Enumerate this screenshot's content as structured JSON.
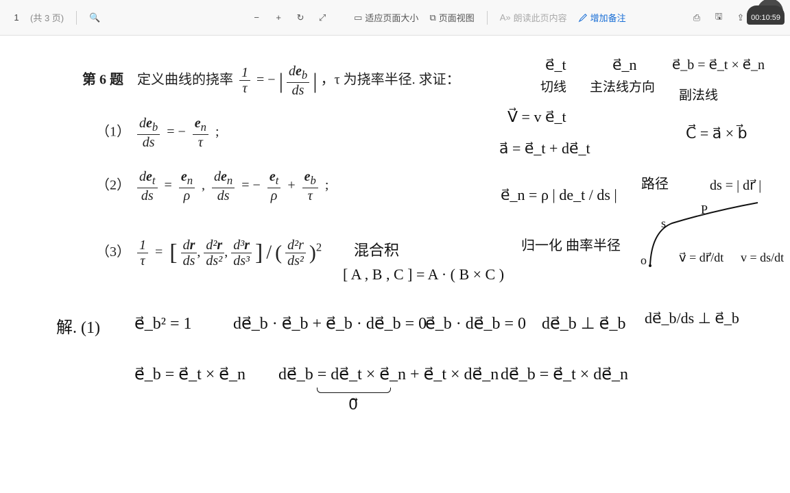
{
  "toolbar": {
    "page_current": "1",
    "page_total": "(共 3 页)",
    "search_icon": "🔍",
    "zoom_out": "−",
    "zoom_in": "+",
    "rotate_icon": "↻",
    "collapse_icon": "⤢",
    "fit_icon": "▭",
    "fit_label": "适应页面大小",
    "pageview_icon": "⧉",
    "pageview_label": "页面视图",
    "read_icon": "A»",
    "read_label": "朗读此页内容",
    "note_icon": "✎",
    "note_label": "增加备注",
    "print_icon": "⎙",
    "save_icon": "🖫",
    "export_icon": "⇪",
    "timer": "00:10:59"
  },
  "problem": {
    "title": "第 6 题",
    "def_pre": "定义曲线的挠率",
    "def_eq_lhs_num": "1",
    "def_eq_lhs_den": "τ",
    "def_eq_mid": " = −",
    "def_eq_rhs_num": "de_b",
    "def_eq_rhs_den": "ds",
    "def_post": "，τ 为挠率半径. 求证：",
    "q1_label": "（1）",
    "q1_eq": "de_b/ds = − e_n/τ ;",
    "q2_label": "（2）",
    "q2_eq": "de_t/ds = e_n/ρ ,  de_n/ds = − e_t/ρ + e_b/τ ;",
    "q3_label": "（3）",
    "q3_eq": "1/τ = [ dr/ds , d²r/ds² , d³r/ds³ ] / ( d²r/ds² )²"
  },
  "hand": {
    "et": "e⃗_t",
    "en": "e⃗_n",
    "eb_eq": "e⃗_b = e⃗_t × e⃗_n",
    "et_lbl": "切线",
    "en_lbl": "主法线方向",
    "eb_lbl": "副法线",
    "v_eq": "V⃗ = v e⃗_t",
    "c_eq": "C⃗ = a⃗ × b⃗",
    "a_eq": "a⃗ =    e⃗_t  +   de⃗_t",
    "en_def": "e⃗_n = ρ | de_t / ds |",
    "guiyi": "归一化  曲率半径",
    "luji": "路径",
    "ds_eq": "ds = | dr⃗ |",
    "P": "P",
    "s": "s",
    "o": "o",
    "vdr": "v⃗ = dr⃗/dt",
    "vds": "v = ds/dt",
    "triple": "[ A , B , C ] = A · ( B × C )",
    "mixed": "混合积",
    "sol_label": "解. (1)",
    "eq1": "e⃗_b² = 1",
    "eq2": "de⃗_b · e⃗_b  +  e⃗_b · de⃗_b = 0",
    "eq3": "e⃗_b · de⃗_b = 0",
    "eq4": "de⃗_b ⊥ e⃗_b",
    "eq5": "de⃗_b/ds ⊥ e⃗_b",
    "eq6": "e⃗_b = e⃗_t × e⃗_n",
    "eq7": "de⃗_b = de⃗_t × e⃗_n + e⃗_t × de⃗_n",
    "eq8": "de⃗_b = e⃗_t × de⃗_n",
    "zero_note": "0⃗"
  }
}
